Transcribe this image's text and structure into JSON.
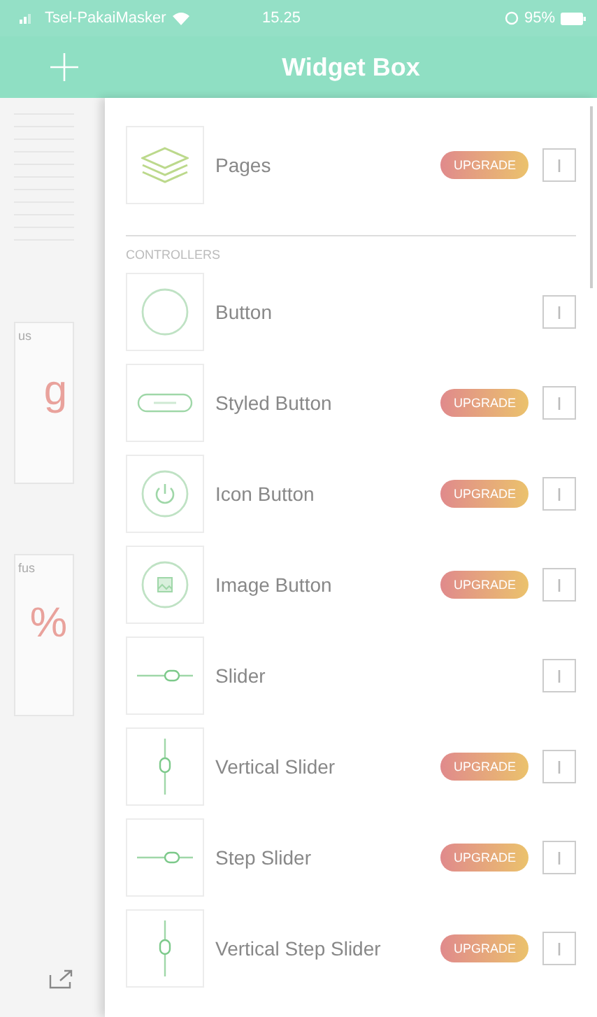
{
  "status_bar": {
    "carrier": "Tsel-PakaiMasker",
    "time": "15.25",
    "battery": "95%"
  },
  "header": {
    "title": "Widget Box"
  },
  "background_app": {
    "cards": [
      {
        "label": "us",
        "value": "g"
      },
      {
        "label": "fus",
        "value": "%"
      }
    ]
  },
  "widget_box": {
    "top_items": [
      {
        "name": "Pages",
        "kind": "layers",
        "badge": "UPGRADE"
      }
    ],
    "sections": [
      {
        "title": "CONTROLLERS",
        "items": [
          {
            "name": "Button",
            "kind": "circle"
          },
          {
            "name": "Styled Button",
            "kind": "styled",
            "badge": "UPGRADE"
          },
          {
            "name": "Icon Button",
            "kind": "power",
            "badge": "UPGRADE"
          },
          {
            "name": "Image Button",
            "kind": "image",
            "badge": "UPGRADE"
          },
          {
            "name": "Slider",
            "kind": "slider"
          },
          {
            "name": "Vertical Slider",
            "kind": "vslider",
            "badge": "UPGRADE"
          },
          {
            "name": "Step Slider",
            "kind": "stepslider",
            "badge": "UPGRADE"
          },
          {
            "name": "Vertical Step Slider",
            "kind": "vstepslider",
            "badge": "UPGRADE"
          }
        ]
      }
    ]
  }
}
